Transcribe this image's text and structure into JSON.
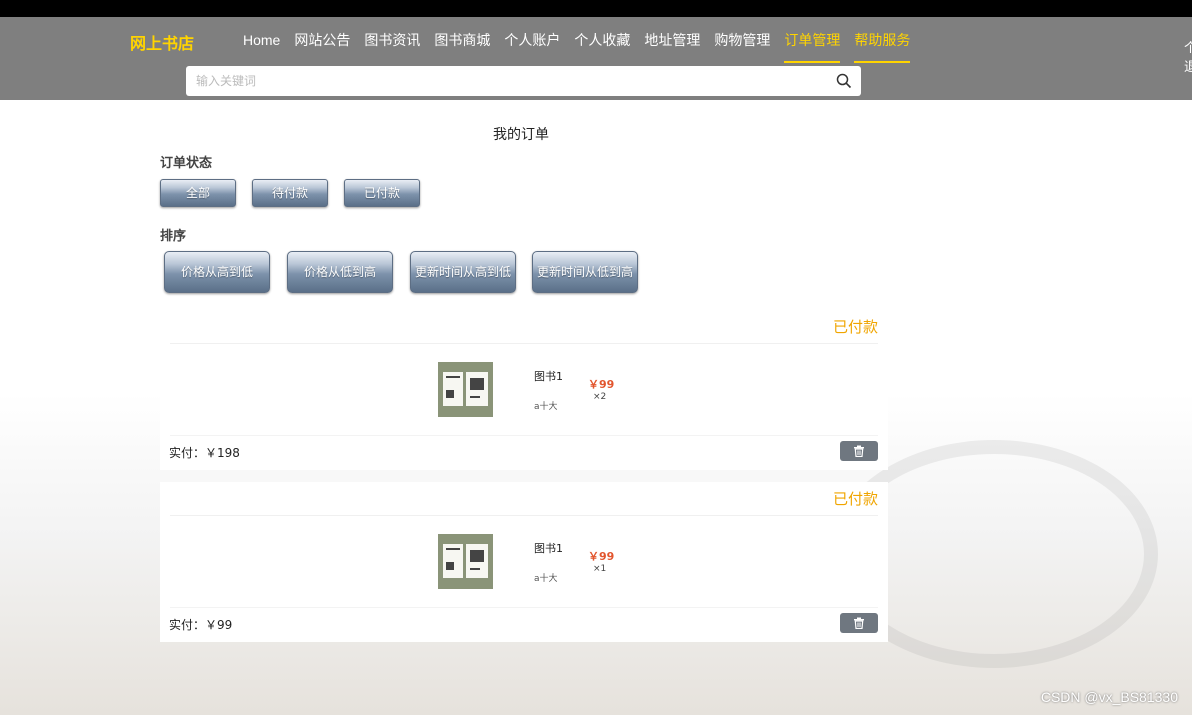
{
  "header": {
    "logo": "网上书店",
    "nav": [
      "Home",
      "网站公告",
      "图书资讯",
      "图书商城",
      "个人账户",
      "个人收藏",
      "地址管理",
      "购物管理",
      "订单管理",
      "帮助服务"
    ],
    "active_nav": "订单管理",
    "edge_text_1": "个",
    "edge_text_2": "退"
  },
  "search": {
    "placeholder": "输入关键词",
    "icon": "search-icon"
  },
  "main": {
    "title": "我的订单",
    "status_label": "订单状态",
    "status_buttons": [
      "全部",
      "待付款",
      "已付款"
    ],
    "sort_label": "排序",
    "sort_buttons": [
      "价格从高到低",
      "价格从低到高",
      "更新时间从高到低",
      "更新时间从低到高"
    ]
  },
  "orders": [
    {
      "status": "已付款",
      "book_name": "图书1",
      "desc": "a十大",
      "price": "￥99",
      "qty": "×2",
      "total": "实付：￥198"
    },
    {
      "status": "已付款",
      "book_name": "图书1",
      "desc": "a十大",
      "price": "￥99",
      "qty": "×1",
      "total": "实付：￥99"
    }
  ],
  "watermark": "CSDN @vx_BS81330",
  "colors": {
    "accent": "#ffd400",
    "header_bg": "#7f7f7f",
    "status": "#f0a500",
    "price": "#e2552d"
  }
}
